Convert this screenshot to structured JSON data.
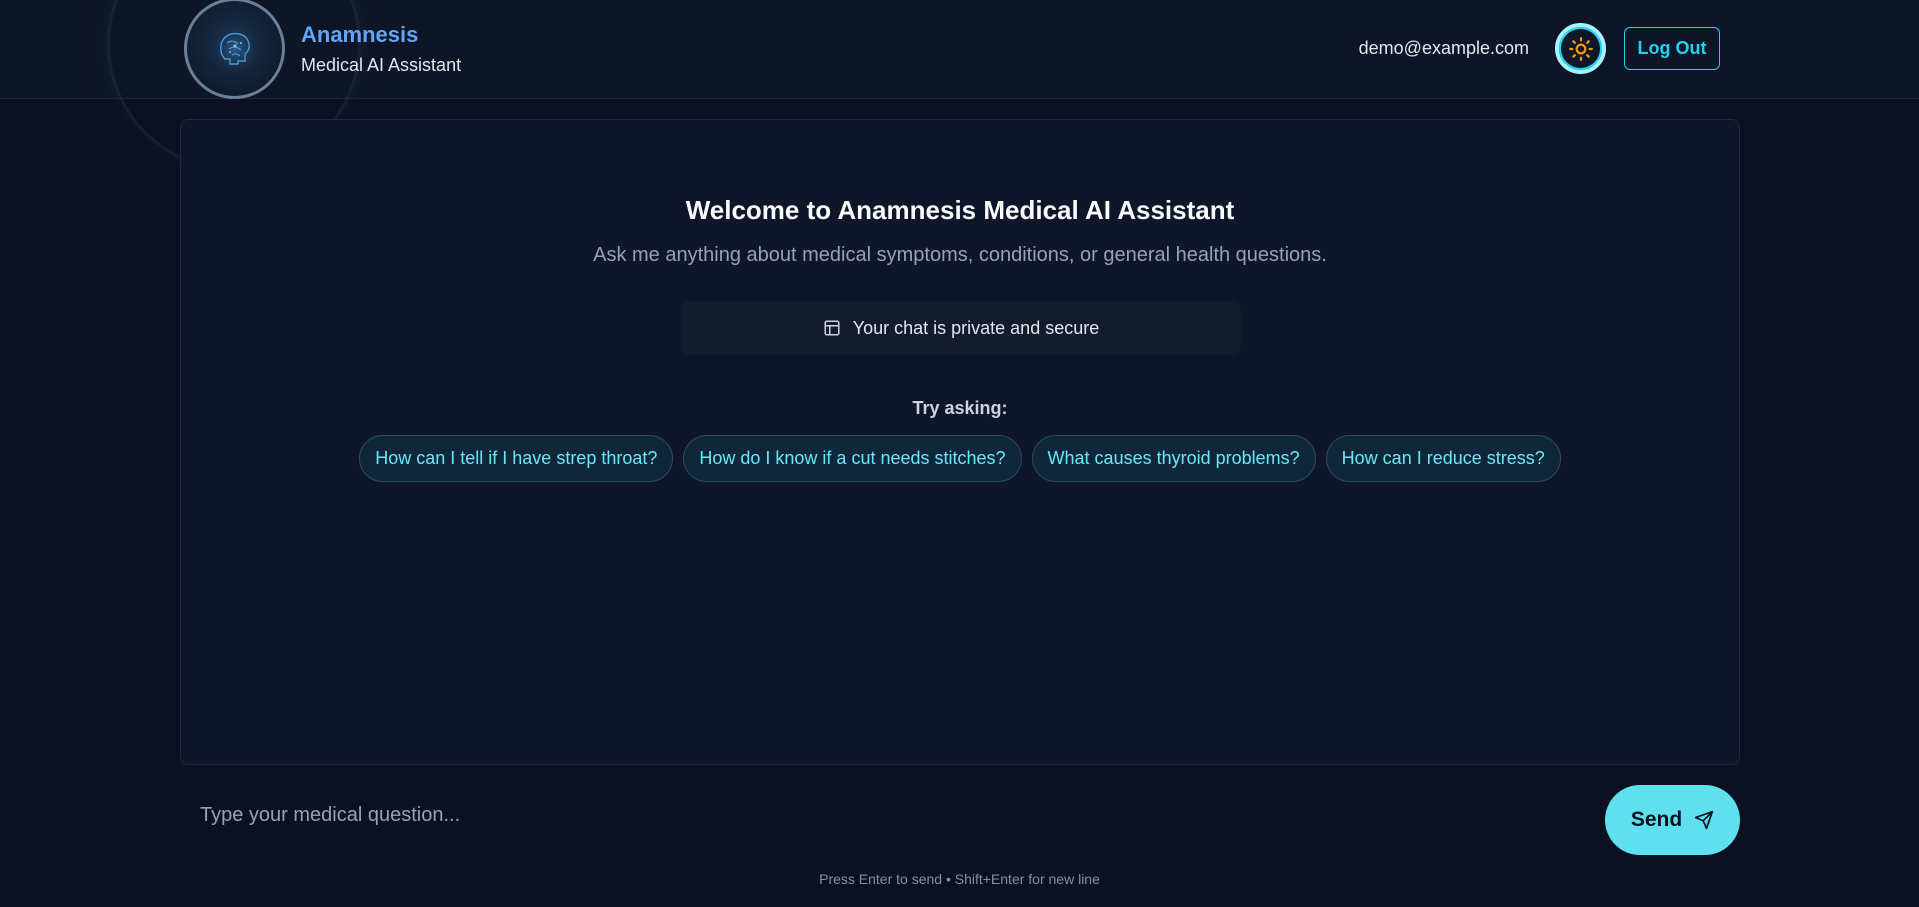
{
  "header": {
    "brand_title": "Anamnesis",
    "brand_subtitle": "Medical AI Assistant",
    "logo_icon": "brain-head-icon",
    "user_email": "demo@example.com",
    "theme_icon": "sun-icon",
    "logout_label": "Log Out"
  },
  "welcome": {
    "title": "Welcome to Anamnesis Medical AI Assistant",
    "subtitle": "Ask me anything about medical symptoms, conditions, or general health questions.",
    "privacy_icon": "layout-panel-icon",
    "privacy_text": "Your chat is private and secure"
  },
  "suggestions": {
    "label": "Try asking:",
    "items": [
      "How can I tell if I have strep throat?",
      "How do I know if a cut needs stitches?",
      "What causes thyroid problems?",
      "How can I reduce stress?"
    ]
  },
  "composer": {
    "placeholder": "Type your medical question...",
    "send_label": "Send",
    "send_icon": "send-icon",
    "hint": "Press Enter to send • Shift+Enter for new line"
  },
  "colors": {
    "accent": "#22d3ee",
    "brand": "#60a5fa",
    "background": "#0b1120",
    "panel": "#0f1629",
    "sun": "#f59e0b"
  }
}
